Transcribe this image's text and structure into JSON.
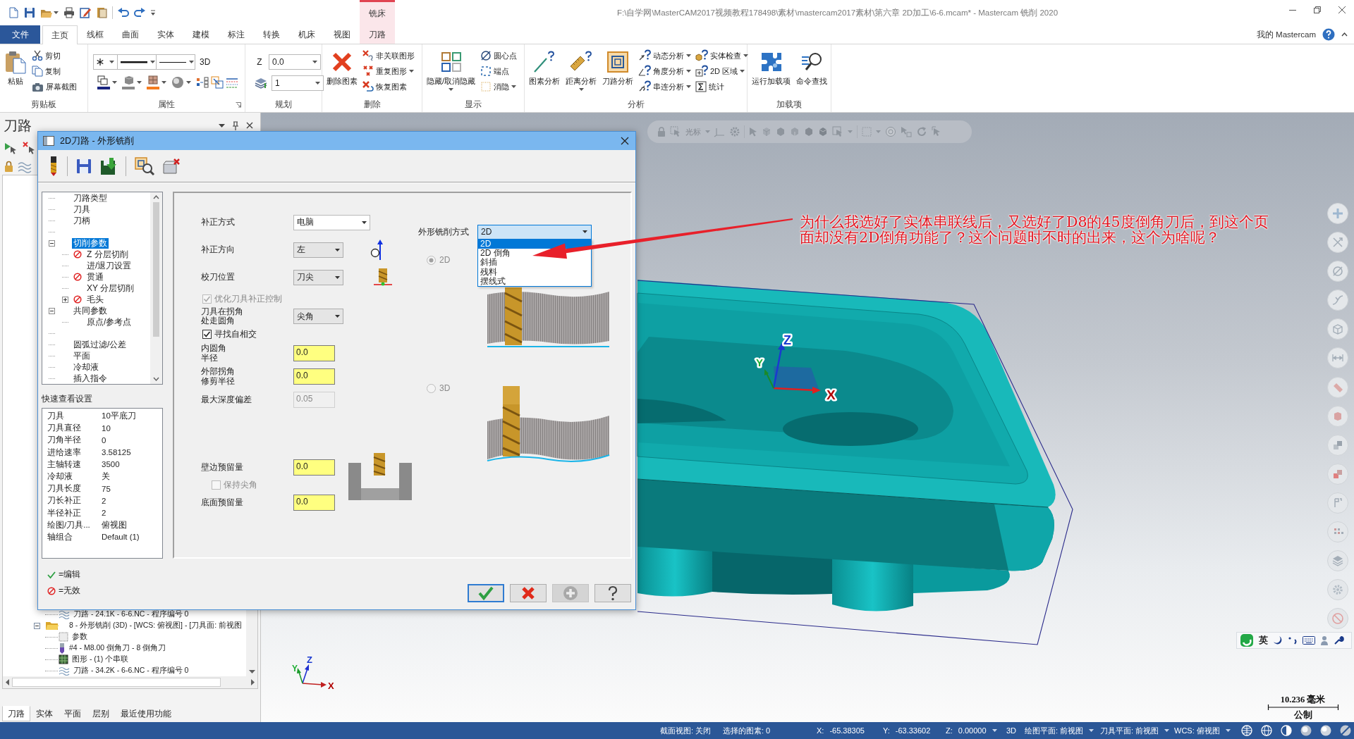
{
  "title_bar": {
    "context_group": "铣床",
    "title": "F:\\自学网\\MasterCAM2017视频教程178498\\素材\\mastercam2017素材\\第六章 2D加工\\6-6.mcam* - Mastercam 铣削 2020"
  },
  "ribbon_tabs": [
    {
      "label": "文件",
      "kind": "file",
      "selected": false
    },
    {
      "label": "主页",
      "kind": "tab",
      "selected": true
    },
    {
      "label": "线框",
      "kind": "tab",
      "selected": false
    },
    {
      "label": "曲面",
      "kind": "tab",
      "selected": false
    },
    {
      "label": "实体",
      "kind": "tab",
      "selected": false
    },
    {
      "label": "建模",
      "kind": "tab",
      "selected": false
    },
    {
      "label": "标注",
      "kind": "tab",
      "selected": false
    },
    {
      "label": "转换",
      "kind": "tab",
      "selected": false
    },
    {
      "label": "机床",
      "kind": "tab",
      "selected": false
    },
    {
      "label": "视图",
      "kind": "tab",
      "selected": false
    },
    {
      "label": "刀路",
      "kind": "context",
      "selected": false
    }
  ],
  "account": {
    "label": "我的 Mastercam"
  },
  "ribbon_groups": [
    {
      "kind": "clipboard",
      "label": "剪贴板",
      "large": [
        {
          "label": "粘贴",
          "menu": false
        }
      ],
      "small": [
        {
          "label": "剪切",
          "menu": false
        },
        {
          "label": "复制",
          "menu": false
        },
        {
          "label": "屏幕截图",
          "menu": false
        }
      ]
    },
    {
      "kind": "attributes",
      "label": "属性",
      "mode": "3D",
      "launcher": true
    },
    {
      "kind": "planning",
      "label": "规划",
      "z_label": "Z",
      "z_value": "0.0",
      "layer": "1"
    },
    {
      "kind": "delete",
      "label": "删除",
      "large": [
        {
          "label": "删除图素",
          "menu": false
        }
      ],
      "small": [
        {
          "label": "非关联图形",
          "menu": false
        },
        {
          "label": "重复图形",
          "menu": true
        },
        {
          "label": "恢复图素",
          "menu": false
        }
      ]
    },
    {
      "kind": "display",
      "label": "显示",
      "large": [
        {
          "label": "隐藏/取消隐藏",
          "menu": true
        }
      ],
      "small": [
        {
          "label": "圆心点",
          "menu": false
        },
        {
          "label": "端点",
          "menu": false
        },
        {
          "label": "消隐",
          "menu": true
        }
      ]
    },
    {
      "kind": "analysis",
      "label": "分析",
      "large": [
        {
          "label": "图素分析",
          "menu": false
        },
        {
          "label": "距离分析",
          "menu": true
        },
        {
          "label": "刀路分析",
          "menu": false
        }
      ],
      "small": [
        {
          "label": "动态分析",
          "menu": true
        },
        {
          "label": "角度分析",
          "menu": true
        },
        {
          "label": "串连分析",
          "menu": true
        },
        {
          "label": "实体检查",
          "menu": true
        },
        {
          "label": "2D 区域",
          "menu": true
        },
        {
          "label": "统计",
          "menu": false
        }
      ]
    },
    {
      "kind": "addins",
      "label": "加载项",
      "large": [
        {
          "label": "运行加载项",
          "menu": false
        },
        {
          "label": "命令查找",
          "menu": false
        }
      ]
    }
  ],
  "toolpath_panel": {
    "title": "刀路",
    "tree": [
      {
        "children": [
          {
            "label": "刀路 - 24.1K - 6-6.NC - 程序编号 0",
            "kind": "toolpath"
          }
        ]
      },
      {
        "label": "8 - 外形铣削 (3D) - [WCS: 俯视图] - [刀具面: 前视图",
        "kind": "operation",
        "expanded": true,
        "children": [
          {
            "label": "参数",
            "kind": "parameters"
          },
          {
            "label": "#4 - M8.00 倒角刀 - 8 倒角刀",
            "kind": "tool"
          },
          {
            "label": "图形 - (1) 个串联",
            "kind": "geometry"
          },
          {
            "label": "刀路 - 34.2K - 6-6.NC - 程序编号 0",
            "kind": "toolpath"
          }
        ]
      }
    ],
    "tabs": [
      {
        "label": "刀路",
        "selected": true
      },
      {
        "label": "实体",
        "selected": false
      },
      {
        "label": "平面",
        "selected": false
      },
      {
        "label": "层别",
        "selected": false
      },
      {
        "label": "最近使用功能",
        "selected": false
      }
    ]
  },
  "selection_bar": {
    "mode": "光标"
  },
  "model_axes": [
    {
      "kind": "z",
      "label": "Z"
    },
    {
      "kind": "y",
      "label": "Y"
    },
    {
      "kind": "x",
      "label": "X"
    }
  ],
  "view_axes": [
    {
      "kind": "z",
      "label": "Z"
    },
    {
      "kind": "y",
      "label": "Y"
    },
    {
      "kind": "x",
      "label": "X"
    }
  ],
  "ime_bar": {
    "language": "英"
  },
  "scale": {
    "length": "10.236 毫米",
    "units": "公制"
  },
  "annotation": {
    "text": "为什么我选好了实体串联线后，又选好了D8的45度倒角刀后，到这个页面却没有2D倒角功能了？这个问题时不时的出来，这个为啥呢？"
  },
  "dialog": {
    "title": "2D刀路 - 外形铣削",
    "tree": [
      [
        {
          "label": "刀路类型",
          "selected": false,
          "invalid": false
        },
        {
          "label": "刀具",
          "selected": false,
          "invalid": false
        },
        {
          "label": "刀柄",
          "selected": false,
          "invalid": false
        }
      ],
      [
        {
          "label": "切削参数",
          "selected": true,
          "invalid": false,
          "expanded": true,
          "children": [
            {
              "label": "Z 分层切削",
              "selected": false,
              "invalid": true
            },
            {
              "label": "进/退刀设置",
              "selected": false,
              "invalid": false
            },
            {
              "label": "贯通",
              "selected": false,
              "invalid": true
            },
            {
              "label": "XY 分层切削",
              "selected": false,
              "invalid": false
            },
            {
              "label": "毛头",
              "selected": false,
              "invalid": true,
              "expanded": false
            }
          ]
        },
        {
          "label": "共同参数",
          "selected": false,
          "invalid": false,
          "expanded": true,
          "children": [
            {
              "label": "原点/参考点",
              "selected": false,
              "invalid": false
            }
          ]
        }
      ],
      [
        {
          "label": "圆弧过滤/公差",
          "selected": false,
          "invalid": false
        },
        {
          "label": "平面",
          "selected": false,
          "invalid": false
        },
        {
          "label": "冷却液",
          "selected": false,
          "invalid": false
        },
        {
          "label": "插入指令",
          "selected": false,
          "invalid": false
        }
      ]
    ],
    "quick_view": {
      "title": "快速查看设置",
      "rows": [
        {
          "name": "刀具",
          "value": "10平底刀"
        },
        {
          "name": "刀具直径",
          "value": "10"
        },
        {
          "name": "刀角半径",
          "value": "0"
        },
        {
          "name": "进给速率",
          "value": "3.58125"
        },
        {
          "name": "主轴转速",
          "value": "3500"
        },
        {
          "name": "冷却液",
          "value": "关"
        },
        {
          "name": "刀具长度",
          "value": "75"
        },
        {
          "name": "刀长补正",
          "value": "2"
        },
        {
          "name": "半径补正",
          "value": "2"
        },
        {
          "name": "绘图/刀具...",
          "value": "俯视图"
        },
        {
          "name": "轴组合",
          "value": "Default (1)"
        }
      ]
    },
    "legend": [
      {
        "kind": "edited",
        "text": "=编辑"
      },
      {
        "kind": "invalid",
        "text": "=无效"
      }
    ],
    "params": [
      {
        "kind": "combo",
        "label": "补正方式",
        "value": "电脑"
      },
      {
        "kind": "select",
        "label": "补正方向",
        "value": "左"
      },
      {
        "kind": "select",
        "label": "校刀位置",
        "value": "刀尖"
      },
      {
        "kind": "checkbox",
        "label": "优化刀具补正控制",
        "checked": true,
        "disabled": true
      },
      {
        "kind": "select",
        "label": "刀具在拐角处走圆角",
        "value": "尖角"
      },
      {
        "kind": "checkbox",
        "label": "寻找自相交",
        "checked": true,
        "disabled": false
      },
      {
        "kind": "number",
        "label": "内圆角半径",
        "value": "0.0",
        "disabled": false
      },
      {
        "kind": "number",
        "label": "外部拐角修剪半径",
        "value": "0.0",
        "disabled": false
      },
      {
        "kind": "number",
        "label": "最大深度偏差",
        "value": "0.05",
        "disabled": true
      }
    ],
    "stock": [
      {
        "kind": "number",
        "label": "壁边预留量",
        "value": "0.0",
        "disabled": false
      },
      {
        "kind": "checkbox",
        "label": "保持尖角",
        "checked": false,
        "disabled": true
      },
      {
        "kind": "number",
        "label": "底面预留量",
        "value": "0.0",
        "disabled": false
      }
    ],
    "profile_type": {
      "label": "外形铣削方式",
      "value": "2D",
      "open": true,
      "options": [
        {
          "label": "2D",
          "selected": true
        },
        {
          "label": "2D 倒角",
          "selected": false
        },
        {
          "label": "斜插",
          "selected": false
        },
        {
          "label": "残料",
          "selected": false
        },
        {
          "label": "摆线式",
          "selected": false
        }
      ]
    },
    "depth_modes": [
      {
        "label": "2D",
        "selected": true,
        "disabled": true
      },
      {
        "label": "3D",
        "selected": false,
        "disabled": true
      }
    ],
    "buttons": [
      {
        "kind": "ok",
        "disabled": false
      },
      {
        "kind": "cancel",
        "disabled": false
      },
      {
        "kind": "add",
        "disabled": true
      },
      {
        "kind": "help",
        "disabled": false
      }
    ]
  },
  "status_bar": [
    {
      "label": "截面视图: 关闭",
      "menu": false
    },
    {
      "label": "选择的图素: 0",
      "menu": false
    },
    {
      "label": "X:",
      "value": "-65.38305",
      "menu": false
    },
    {
      "label": "Y:",
      "value": "-63.33602",
      "menu": false
    },
    {
      "label": "Z:",
      "value": "0.00000",
      "menu": true
    },
    {
      "label": "3D",
      "menu": false
    },
    {
      "label": "绘图平面: 前视图",
      "menu": true
    },
    {
      "label": "刀具平面: 前视图",
      "menu": true
    },
    {
      "label": "WCS: 俯视图",
      "menu": true
    }
  ]
}
